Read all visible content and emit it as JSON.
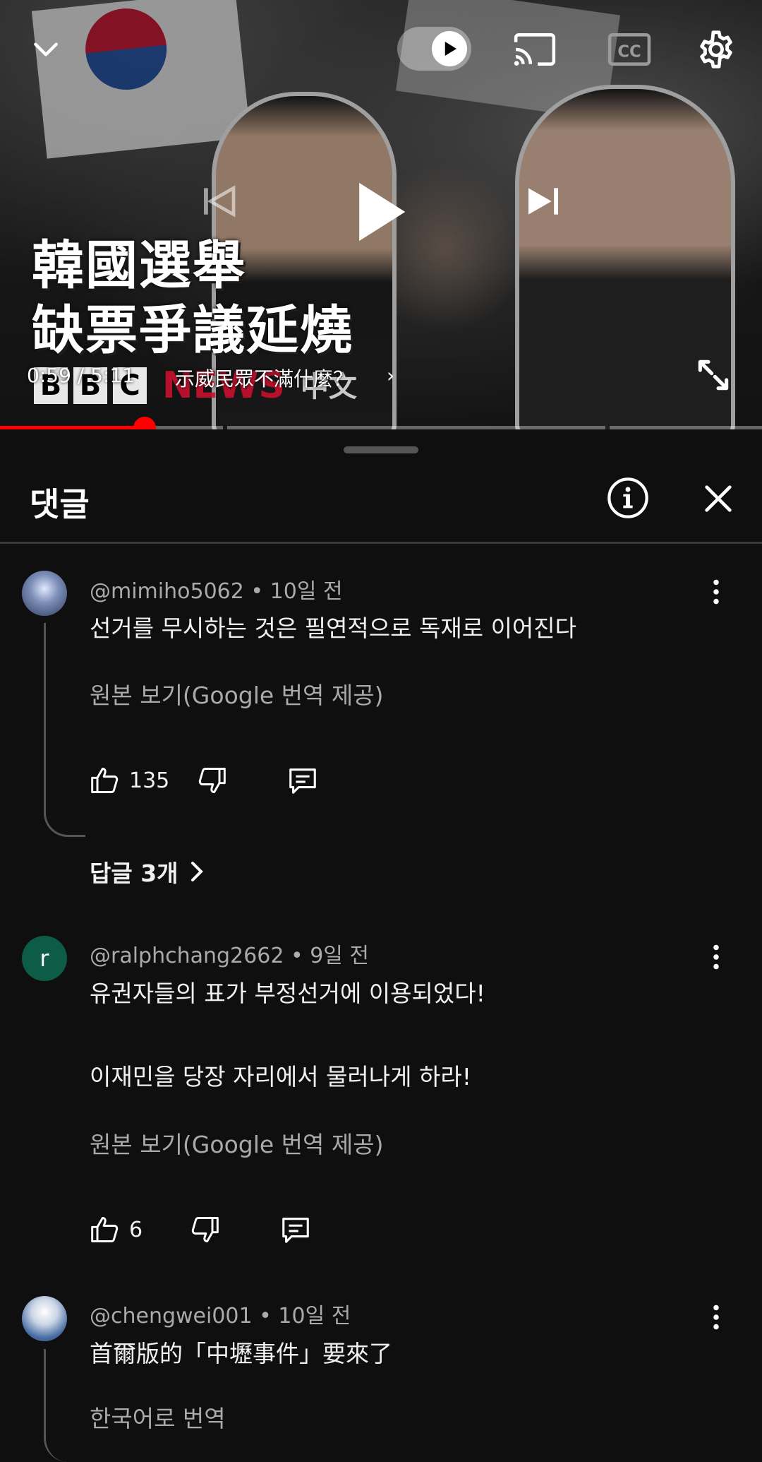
{
  "player": {
    "overlay_text": "韓國選舉\n缺票爭議延燒",
    "channel_logo": {
      "letters": [
        "B",
        "B",
        "C"
      ],
      "word": "NEWS",
      "suffix": "中文"
    },
    "time": "0:59 / 5:11",
    "chapter": "示威民眾不滿什麼？",
    "chapter_chevron": "›",
    "progress_fraction": 0.19,
    "controls": {
      "collapse": "chevron-down-icon",
      "autoplay": "autoplay-toggle-icon",
      "cast": "cast-icon",
      "captions": "cc-icon",
      "settings": "gear-icon",
      "previous": "previous-icon",
      "play": "play-icon",
      "next": "next-icon",
      "fullscreen": "fullscreen-icon"
    },
    "accent_color": "#ff0000"
  },
  "comments_panel": {
    "title": "댓글",
    "info_icon": "info-icon",
    "close_icon": "close-icon"
  },
  "comments": [
    {
      "author": "@mimiho5062",
      "age": "10일 전",
      "text": "선거를 무시하는 것은 필연적으로 독재로 이어진다",
      "translation_link": "원본 보기(Google 번역 제공)",
      "likes": "135",
      "replies_label": "답글 3개",
      "avatar_letter": ""
    },
    {
      "author": "@ralphchang2662",
      "age": "9일 전",
      "text_lines": [
        "유권자들의 표가 부정선거에 이용되었다!",
        "이재민을 당장 자리에서 물러나게 하라!"
      ],
      "translation_link": "원본 보기(Google 번역 제공)",
      "likes": "6",
      "avatar_letter": "r",
      "avatar_color": "#0c5c48"
    },
    {
      "author": "@chengwei001",
      "age": "10일 전",
      "text": "首爾版的「中壢事件」要來了",
      "translation_link": "한국어로 번역",
      "avatar_letter": ""
    }
  ],
  "separator": "•"
}
